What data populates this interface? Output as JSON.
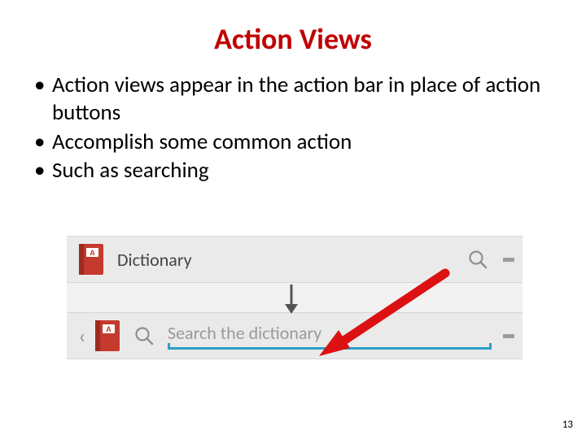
{
  "title": "Action Views",
  "bullets": [
    "Action views appear in the action bar in place of action buttons",
    "Accomplish some common action",
    "Such as searching"
  ],
  "figure": {
    "top_bar": {
      "app_label": "Dictionary",
      "icon_letter": "A"
    },
    "bottom_bar": {
      "icon_letter": "A",
      "search_placeholder": "Search the dictionary"
    }
  },
  "page_number": "13"
}
